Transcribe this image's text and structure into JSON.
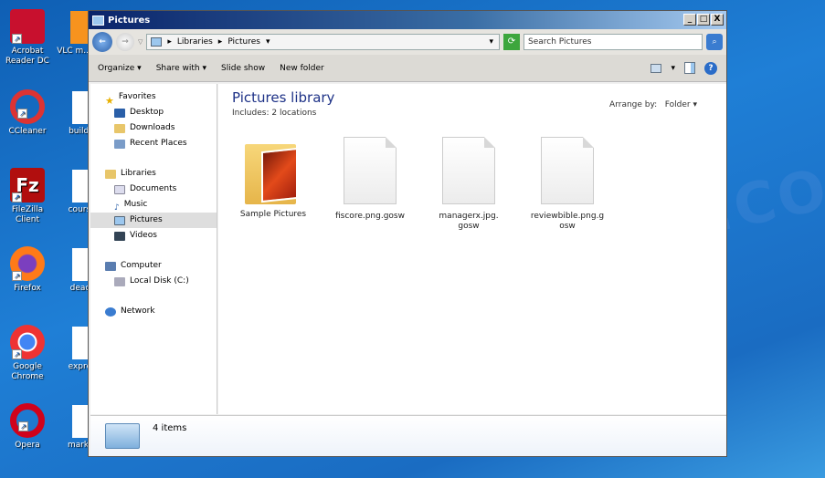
{
  "desktop": {
    "icons": [
      {
        "label": "Acrobat Reader DC",
        "color": "#c8102e"
      },
      {
        "label": "CCleaner",
        "color": "#d33"
      },
      {
        "label": "FileZilla Client",
        "color": "#b10e0e"
      },
      {
        "label": "Firefox",
        "color": "#ff7a18"
      },
      {
        "label": "Google Chrome",
        "color": "#4285f4"
      },
      {
        "label": "Opera",
        "color": "#d0021b"
      }
    ],
    "icons2": [
      {
        "label": "VLC m... play"
      },
      {
        "label": "buildthi"
      },
      {
        "label": "courses"
      },
      {
        "label": "deadbi"
      },
      {
        "label": "express"
      },
      {
        "label": "markwe"
      }
    ]
  },
  "watermark": "MYANTISPYWARE.CO",
  "window": {
    "title": "Pictures",
    "buttons": {
      "min": "_",
      "max": "□",
      "close": "X"
    },
    "breadcrumb": [
      "Libraries",
      "Pictures"
    ],
    "search_placeholder": "Search Pictures",
    "toolbar": {
      "organize": "Organize ▾",
      "share": "Share with ▾",
      "slideshow": "Slide show",
      "newfolder": "New folder"
    },
    "nav": {
      "favorites": "Favorites",
      "desktop": "Desktop",
      "downloads": "Downloads",
      "recent": "Recent Places",
      "libraries": "Libraries",
      "documents": "Documents",
      "music": "Music",
      "pictures": "Pictures",
      "videos": "Videos",
      "computer": "Computer",
      "localdisk": "Local Disk (C:)",
      "network": "Network"
    },
    "content": {
      "title": "Pictures library",
      "includes": "Includes:",
      "locations": "2 locations",
      "arrange_label": "Arrange by:",
      "arrange_value": "Folder ▾",
      "files": [
        "Sample Pictures",
        "fiscore.png.gosw",
        "managerx.jpg.gosw",
        "reviewbible.png.gosw"
      ]
    },
    "status": "4 items"
  }
}
